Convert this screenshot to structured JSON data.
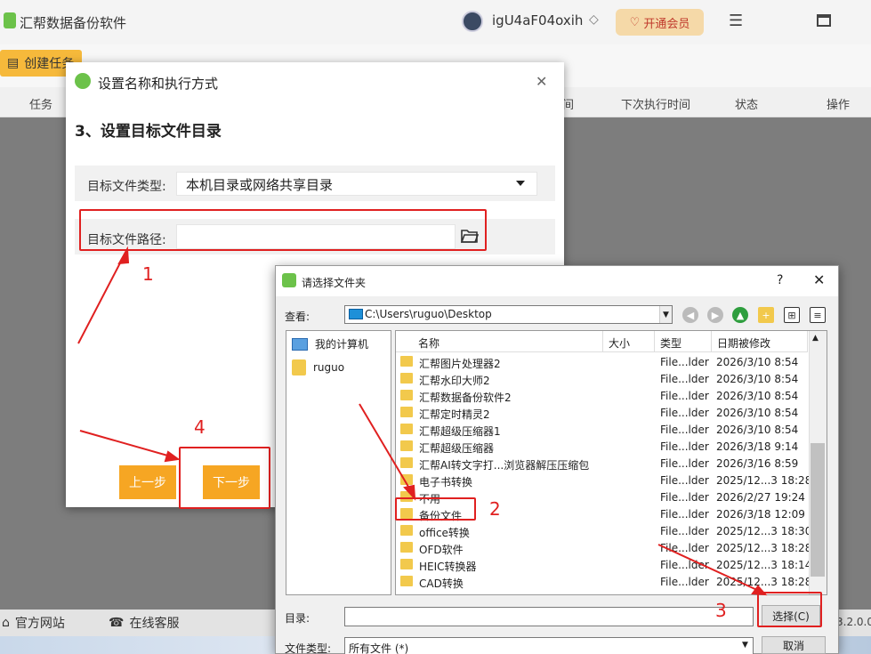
{
  "app": {
    "title": "汇帮数据备份软件",
    "username": "igU4aF04oxih",
    "vip_label": "开通会员",
    "create_task_label": "创建任务",
    "columns": [
      "任务",
      "间",
      "下次执行时间",
      "状态",
      "操作"
    ],
    "footer": {
      "website": "官方网站",
      "support": "在线客服",
      "version": "3.2.0.0"
    }
  },
  "dialog1": {
    "title": "设置名称和执行方式",
    "step_title": "3、设置目标文件目录",
    "target_type_label": "目标文件类型:",
    "target_type_value": "本机目录或网络共享目录",
    "target_path_label": "目标文件路径:",
    "target_path_value": "",
    "prev_label": "上一步",
    "next_label": "下一步"
  },
  "dialog2": {
    "title": "请选择文件夹",
    "help": "?",
    "lookin_label": "查看:",
    "lookin_value": "C:\\Users\\ruguo\\Desktop",
    "sidebar": [
      {
        "label": "我的计算机",
        "icon": "computer-icon"
      },
      {
        "label": "ruguo",
        "icon": "user-folder-icon"
      }
    ],
    "columns": [
      "名称",
      "大小",
      "类型",
      "日期被修改"
    ],
    "files": [
      {
        "name": "汇帮图片处理器2",
        "size": "",
        "type": "File...lder",
        "date": "2026/3/10 8:54"
      },
      {
        "name": "汇帮水印大师2",
        "size": "",
        "type": "File...lder",
        "date": "2026/3/10 8:54"
      },
      {
        "name": "汇帮数据备份软件2",
        "size": "",
        "type": "File...lder",
        "date": "2026/3/10 8:54"
      },
      {
        "name": "汇帮定时精灵2",
        "size": "",
        "type": "File...lder",
        "date": "2026/3/10 8:54"
      },
      {
        "name": "汇帮超级压缩器1",
        "size": "",
        "type": "File...lder",
        "date": "2026/3/10 8:54"
      },
      {
        "name": "汇帮超级压缩器",
        "size": "",
        "type": "File...lder",
        "date": "2026/3/18 9:14"
      },
      {
        "name": "汇帮AI转文字打...浏览器解压压缩包",
        "size": "",
        "type": "File...lder",
        "date": "2026/3/16 8:59"
      },
      {
        "name": "电子书转换",
        "size": "",
        "type": "File...lder",
        "date": "2025/12...3 18:28"
      },
      {
        "name": "不用",
        "size": "",
        "type": "File...lder",
        "date": "2026/2/27 19:24"
      },
      {
        "name": "备份文件",
        "size": "",
        "type": "File...lder",
        "date": "2026/3/18 12:09"
      },
      {
        "name": "office转换",
        "size": "",
        "type": "File...lder",
        "date": "2025/12...3 18:30"
      },
      {
        "name": "OFD软件",
        "size": "",
        "type": "File...lder",
        "date": "2025/12...3 18:28"
      },
      {
        "name": "HEIC转换器",
        "size": "",
        "type": "File...lder",
        "date": "2025/12...3 18:14"
      },
      {
        "name": "CAD转换",
        "size": "",
        "type": "File...lder",
        "date": "2025/12...3 18:28"
      }
    ],
    "dir_label": "目录:",
    "dir_value": "",
    "select_label": "选择(C)",
    "filetype_label": "文件类型:",
    "filetype_value": "所有文件 (*)",
    "cancel_label": "取消"
  },
  "annotations": {
    "n1": "1",
    "n2": "2",
    "n3": "3",
    "n4": "4",
    "color": "#e02020"
  }
}
